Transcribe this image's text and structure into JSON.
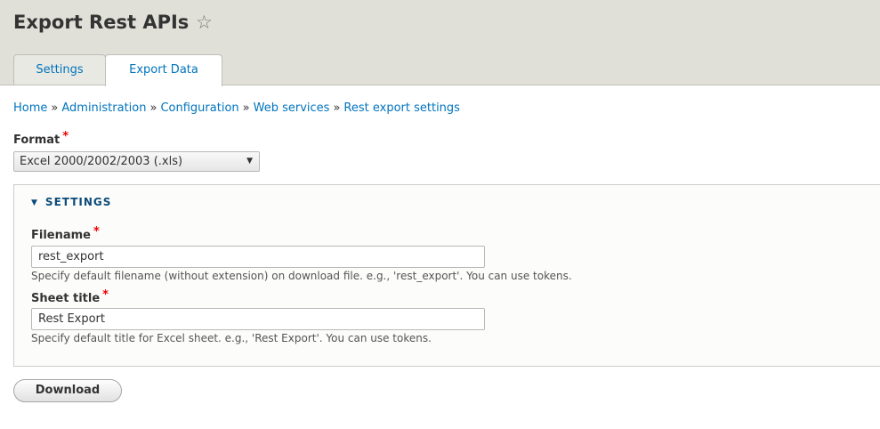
{
  "page": {
    "title": "Export Rest APIs",
    "star_icon": "star-outline-icon"
  },
  "tabs": [
    {
      "label": "Settings",
      "active": false
    },
    {
      "label": "Export Data",
      "active": true
    }
  ],
  "breadcrumb": {
    "separator": "»",
    "items": [
      "Home",
      "Administration",
      "Configuration",
      "Web services",
      "Rest export settings"
    ]
  },
  "format": {
    "label": "Format",
    "required_mark": "*",
    "selected": "Excel 2000/2002/2003 (.xls)"
  },
  "settings": {
    "legend": "SETTINGS",
    "filename": {
      "label": "Filename",
      "required_mark": "*",
      "value": "rest_export",
      "description": "Specify default filename (without extension) on download file. e.g., 'rest_export'. You can use tokens."
    },
    "sheet_title": {
      "label": "Sheet title",
      "required_mark": "*",
      "value": "Rest Export",
      "description": "Specify default title for Excel sheet. e.g., 'Rest Export'. You can use tokens."
    }
  },
  "actions": {
    "download_label": "Download"
  },
  "colors": {
    "link": "#0074bd",
    "required": "#ee0000",
    "header_bg": "#e0e0d8"
  }
}
